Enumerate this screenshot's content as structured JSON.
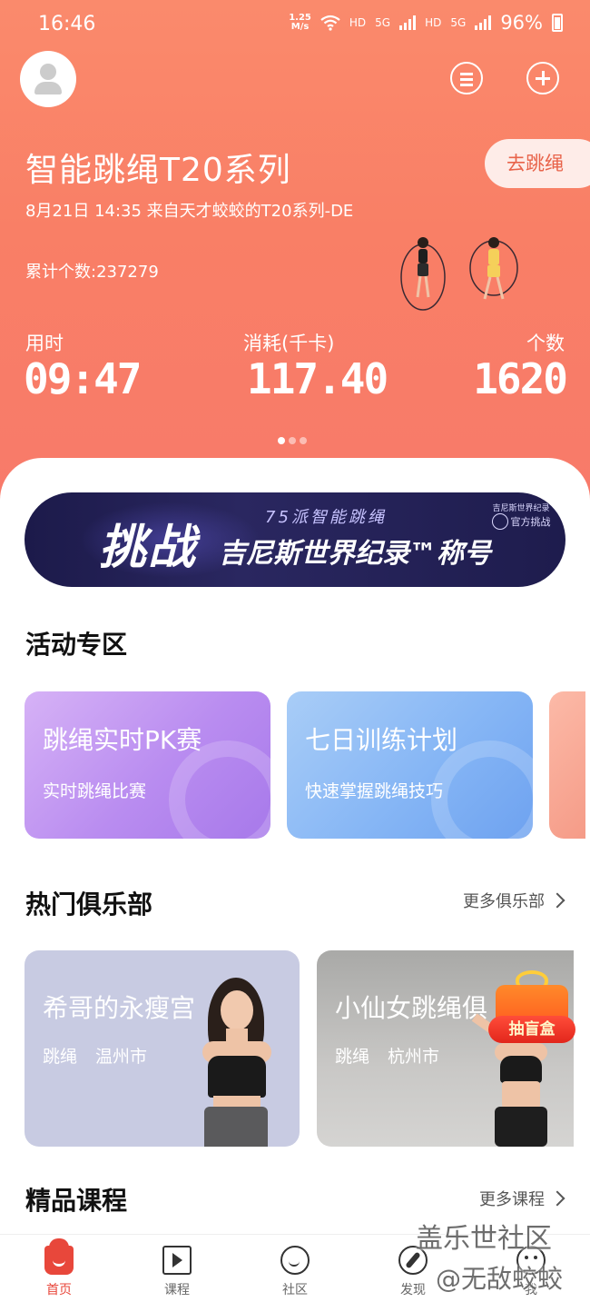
{
  "status_bar": {
    "time": "16:46",
    "speed": "1.25\nM/s",
    "hd1": "HD",
    "net1": "5G",
    "hd2": "HD",
    "net2": "5G",
    "battery": "96%"
  },
  "header": {
    "device_title": "智能跳绳T20系列",
    "go_button": "去跳绳",
    "sync_info": "8月21日 14:35 来自天才蛟蛟的T20系列-DE",
    "total_count": "累计个数:237279",
    "stats": [
      {
        "label": "用时",
        "value": "09:47"
      },
      {
        "label": "消耗(千卡)",
        "value": "117.40"
      },
      {
        "label": "个数",
        "value": "1620"
      }
    ],
    "page_indicator": {
      "count": 3,
      "active": 0
    }
  },
  "banner": {
    "subtitle": "75派智能跳绳",
    "main": "挑战",
    "main2": "吉尼斯世界纪录™称号",
    "badge_top": "吉尼斯世界纪录",
    "badge_label": "官方挑战"
  },
  "activities": {
    "title": "活动专区",
    "cards": [
      {
        "title": "跳绳实时PK赛",
        "subtitle": "实时跳绳比赛"
      },
      {
        "title": "七日训练计划",
        "subtitle": "快速掌握跳绳技巧"
      }
    ]
  },
  "clubs": {
    "title": "热门俱乐部",
    "more": "更多俱乐部",
    "cards": [
      {
        "name": "希哥的永瘦宫",
        "tag": "跳绳",
        "city": "温州市"
      },
      {
        "name": "小仙女跳绳俱",
        "tag": "跳绳",
        "city": "杭州市"
      }
    ],
    "gift_label": "抽盲盒"
  },
  "courses": {
    "title": "精品课程",
    "more": "更多课程"
  },
  "tabbar": [
    {
      "label": "首页",
      "icon": "home-icon",
      "active": true
    },
    {
      "label": "课程",
      "icon": "course-icon",
      "active": false
    },
    {
      "label": "社区",
      "icon": "community-icon",
      "active": false
    },
    {
      "label": "发现",
      "icon": "discover-icon",
      "active": false
    },
    {
      "label": "我",
      "icon": "me-icon",
      "active": false
    }
  ],
  "watermark": {
    "line1": "盖乐世社区",
    "line2": "@无敌蛟蛟"
  },
  "colors": {
    "accent": "#e8473b",
    "hero": "#f97f66"
  }
}
